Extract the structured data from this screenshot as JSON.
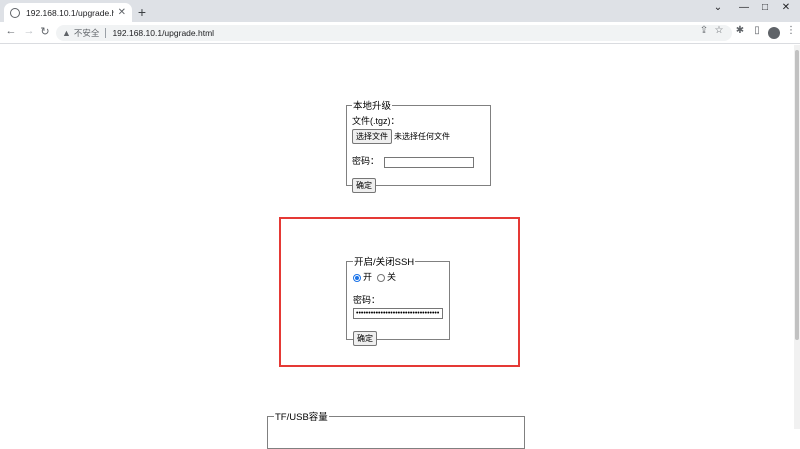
{
  "browser": {
    "tab_title": "192.168.10.1/upgrade.html",
    "new_tab_label": "+",
    "security_label": "不安全",
    "url": "192.168.10.1/upgrade.html"
  },
  "upgrade": {
    "legend": "本地升级",
    "file_label": "文件(.tgz)：",
    "choose_file": "选择文件",
    "no_file": "未选择任何文件",
    "password_label": "密码：",
    "confirm": "确定"
  },
  "ssh": {
    "legend": "开启/关闭SSH",
    "on_label": "开",
    "off_label": "关",
    "password_label": "密码：",
    "password_value": "••••••••••••••••••••••••••••••••••",
    "confirm": "确定"
  },
  "storage": {
    "legend": "TF/USB容量"
  },
  "colors": {
    "highlight": "#e53935",
    "radio_accent": "#1a73e8"
  }
}
